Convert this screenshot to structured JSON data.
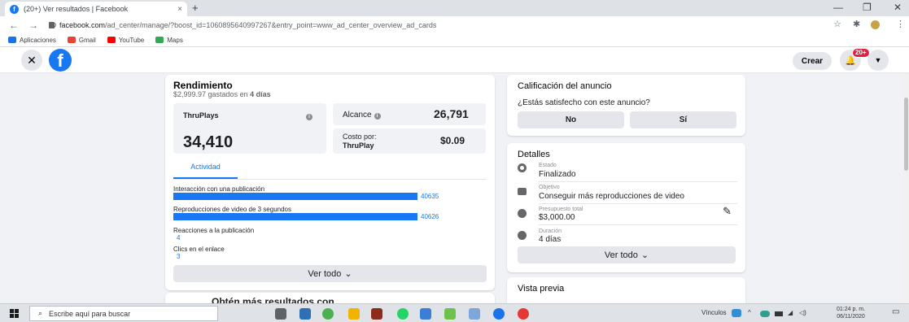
{
  "browser": {
    "tab_title": "(20+) Ver resultados | Facebook",
    "tab_close": "×",
    "new_tab": "+",
    "url_host": "facebook.com",
    "url_path": "/ad_center/manage/?boost_id=1060895640997267&entry_point=www_ad_center_overview_ad_cards",
    "bookmarks": [
      {
        "label": "Aplicaciones",
        "color": "#1a73e8"
      },
      {
        "label": "Gmail",
        "color": "#ea4335"
      },
      {
        "label": "YouTube",
        "color": "#ff0000"
      },
      {
        "label": "Maps",
        "color": "#34a853"
      }
    ]
  },
  "fb": {
    "logo": "f",
    "create_label": "Crear",
    "notif_count": "20+"
  },
  "performance": {
    "title": "Rendimiento",
    "spent_prefix": "$2,999.97 gastados en ",
    "spent_days": "4 días",
    "thruplays_label": "ThruPlays",
    "thruplays_value": "34,410",
    "reach_label": "Alcance",
    "reach_value": "26,791",
    "cost_label_1": "Costo por:",
    "cost_label_2": "ThruPlay",
    "cost_value": "$0.09",
    "tab_label": "Actividad",
    "activities": [
      {
        "label": "Interacción con una publicación",
        "value": "40635",
        "fill": 1.0
      },
      {
        "label": "Reproducciones de video de 3 segundos",
        "value": "40626",
        "fill": 0.9998
      },
      {
        "label": "Reacciones a la publicación",
        "value": "4"
      },
      {
        "label": "Clics en el enlace",
        "value": "3"
      }
    ],
    "see_all": "Ver todo",
    "next_section": "Obtén más resultados con..."
  },
  "rating": {
    "title": "Calificación del anuncio",
    "question": "¿Estás satisfecho con este anuncio?",
    "no_label": "No",
    "yes_label": "Sí"
  },
  "details": {
    "title": "Detalles",
    "status_label": "Estado",
    "status_value": "Finalizado",
    "objective_label": "Objetivo",
    "objective_value": "Conseguir más reproducciones de video",
    "budget_label": "Presupuesto total",
    "budget_value": "$3,000.00",
    "duration_label": "Duración",
    "duration_value": "4 días",
    "see_all": "Ver todo"
  },
  "preview": {
    "title": "Vista previa"
  },
  "taskbar": {
    "search_placeholder": "Escribe aquí para buscar",
    "links_label": "Vínculos",
    "time": "01:24 p. m.",
    "date": "06/11/2020"
  }
}
